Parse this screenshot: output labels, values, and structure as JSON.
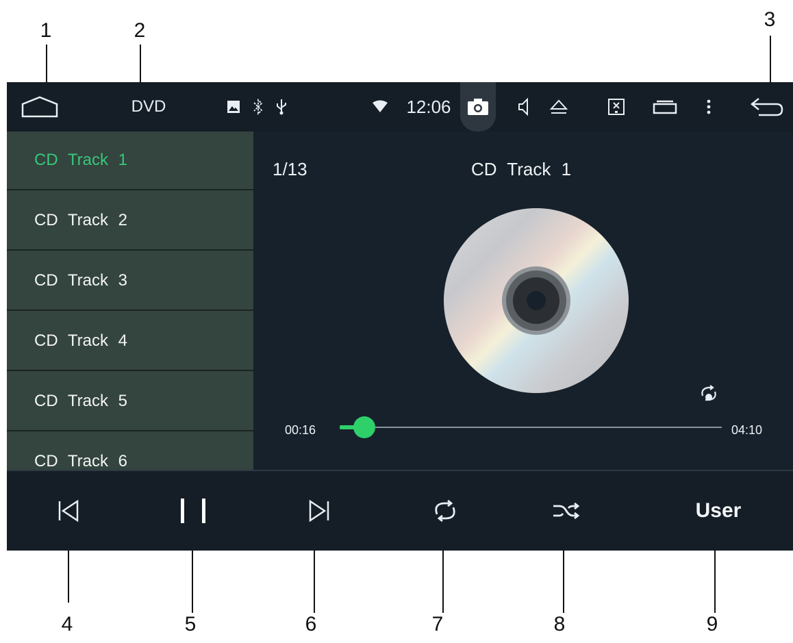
{
  "callouts": [
    "1",
    "2",
    "3",
    "4",
    "5",
    "6",
    "7",
    "8",
    "9"
  ],
  "status_bar": {
    "title": "DVD",
    "clock": "12:06",
    "icons": [
      "home-icon",
      "image-icon",
      "bluetooth-icon",
      "usb-icon",
      "wifi-icon",
      "camera-icon",
      "volume-icon",
      "eject-icon",
      "screen-off-icon",
      "recent-apps-icon",
      "more-menu-icon",
      "back-icon"
    ]
  },
  "tracklist": {
    "items": [
      {
        "label": "CD  Track  1",
        "active": true
      },
      {
        "label": "CD  Track  2",
        "active": false
      },
      {
        "label": "CD  Track  3",
        "active": false
      },
      {
        "label": "CD  Track  4",
        "active": false
      },
      {
        "label": "CD  Track  5",
        "active": false
      },
      {
        "label": "CD  Track  6",
        "active": false
      }
    ]
  },
  "player": {
    "counter": "1/13",
    "title": "CD  Track  1",
    "time_current": "00:16",
    "time_total": "04:10",
    "progress": 0.064,
    "repeat_mode_icon": "repeat-one-icon"
  },
  "controls": {
    "buttons": [
      "previous-icon",
      "pause-icon",
      "next-icon",
      "repeat-icon",
      "shuffle-icon"
    ],
    "user_label": "User"
  },
  "colors": {
    "accent": "#2ed06a",
    "active_track": "#37c77a",
    "screen_bg": "#17212b",
    "list_bg": "#34443e"
  }
}
